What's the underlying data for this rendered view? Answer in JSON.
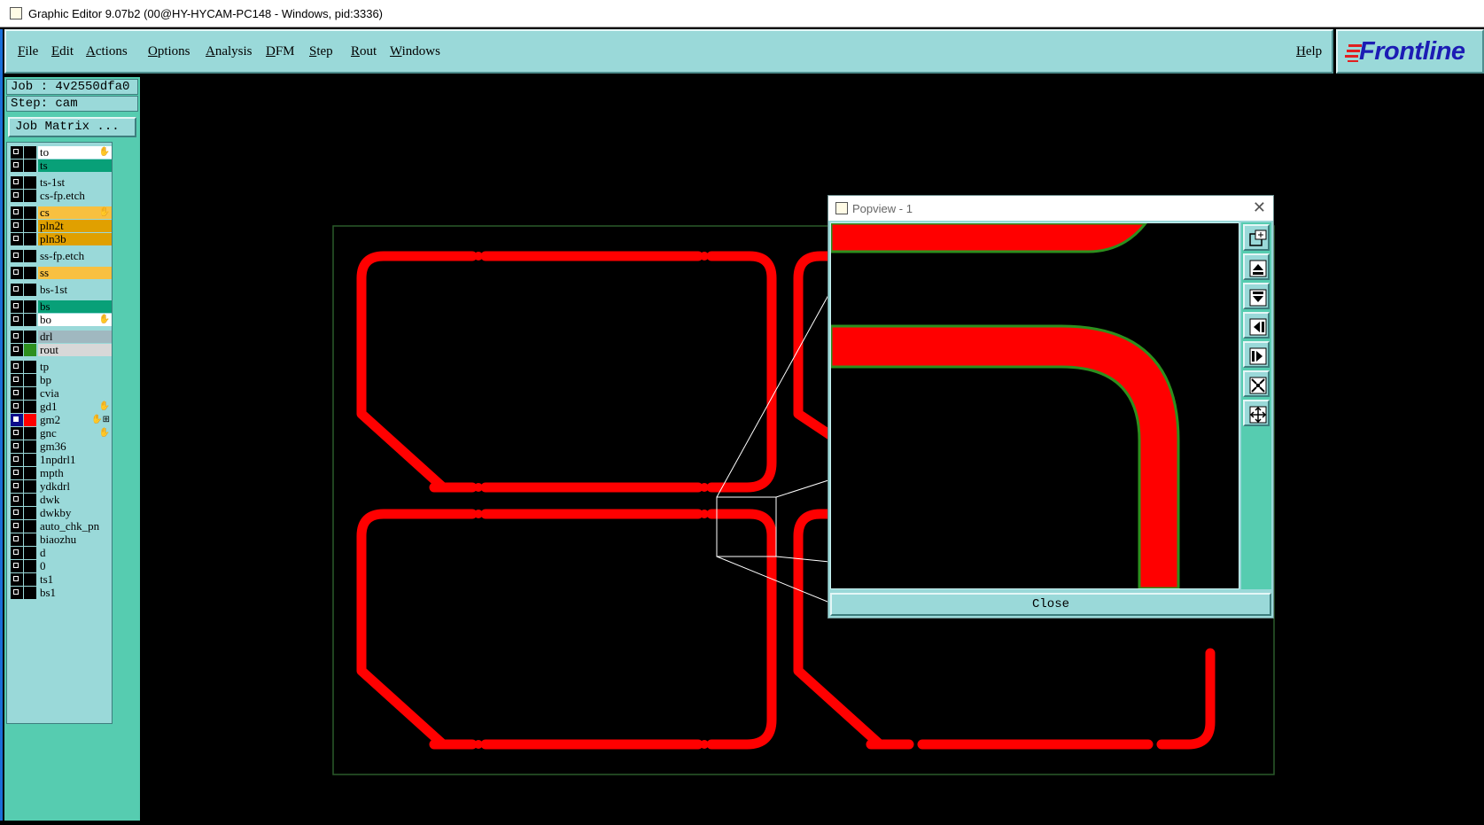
{
  "window": {
    "title": "Graphic Editor 9.07b2 (00@HY-HYCAM-PC148 - Windows, pid:3336)"
  },
  "menu": {
    "items": [
      "File",
      "Edit",
      "Actions",
      "Options",
      "Analysis",
      "DFM",
      "Step",
      "Rout",
      "Windows"
    ],
    "help": "Help"
  },
  "brand": {
    "logo_text": "Frontline",
    "logo_color": "#1c1cb4",
    "accent": "#e02020"
  },
  "job": {
    "job_label": "Job : 4v2550dfa0",
    "step_label": "Step: cam",
    "matrix_button": "Job Matrix ..."
  },
  "layers": [
    {
      "name": "to",
      "bg": "#ffffff",
      "mark": "✋"
    },
    {
      "name": "ts",
      "bg": "#08a078"
    },
    {
      "name": "ts-1st",
      "bg": "#9ad9d9"
    },
    {
      "name": "cs-fp.etch",
      "bg": "#9ad9d9"
    },
    {
      "name": "cs",
      "bg": "#f8c040",
      "mark": "✋"
    },
    {
      "name": "pln2t",
      "bg": "#e0a000"
    },
    {
      "name": "pln3b",
      "bg": "#e0a000"
    },
    {
      "name": "ss-fp.etch",
      "bg": "#9ad9d9"
    },
    {
      "name": "ss",
      "bg": "#f8c040"
    },
    {
      "name": "bs-1st",
      "bg": "#9ad9d9"
    },
    {
      "name": "bs",
      "bg": "#08a078"
    },
    {
      "name": "bo",
      "bg": "#ffffff",
      "mark": "✋"
    },
    {
      "name": "drl",
      "bg": "#a0b8c0"
    },
    {
      "name": "rout",
      "bg": "#d8d8d8",
      "swatch": "#2d8f1e"
    },
    {
      "name": "tp",
      "bg": "#9ad9d9"
    },
    {
      "name": "bp",
      "bg": "#9ad9d9"
    },
    {
      "name": "cvia",
      "bg": "#9ad9d9"
    },
    {
      "name": "gd1",
      "bg": "#9ad9d9",
      "mark": "✋"
    },
    {
      "name": "gm2",
      "bg": "#9ad9d9",
      "mark": "✋⊞",
      "checked": true,
      "swatch": "#ff0000"
    },
    {
      "name": "gnc",
      "bg": "#9ad9d9",
      "mark": "✋"
    },
    {
      "name": "gm36",
      "bg": "#9ad9d9"
    },
    {
      "name": "1npdrl1",
      "bg": "#9ad9d9"
    },
    {
      "name": "mpth",
      "bg": "#9ad9d9"
    },
    {
      "name": "ydkdrl",
      "bg": "#9ad9d9"
    },
    {
      "name": "dwk",
      "bg": "#9ad9d9"
    },
    {
      "name": "dwkby",
      "bg": "#9ad9d9"
    },
    {
      "name": "auto_chk_pn",
      "bg": "#9ad9d9"
    },
    {
      "name": "biaozhu",
      "bg": "#9ad9d9"
    },
    {
      "name": "d",
      "bg": "#9ad9d9"
    },
    {
      "name": "0",
      "bg": "#9ad9d9"
    },
    {
      "name": "ts1",
      "bg": "#9ad9d9"
    },
    {
      "name": "bs1",
      "bg": "#9ad9d9"
    }
  ],
  "popview": {
    "title": "Popview - 1",
    "close_label": "Close",
    "tools": [
      "zoom-home-icon",
      "pan-up-icon",
      "pan-down-icon",
      "pan-left-icon",
      "pan-right-icon",
      "zoom-in-icon",
      "zoom-out-icon"
    ]
  },
  "colors": {
    "trace": "#ff0000",
    "trace_outline": "#2d8f1e",
    "panel_bg": "#9ad9d9",
    "panel_dark": "#56ccb0",
    "profile": "#2a5a2a"
  }
}
